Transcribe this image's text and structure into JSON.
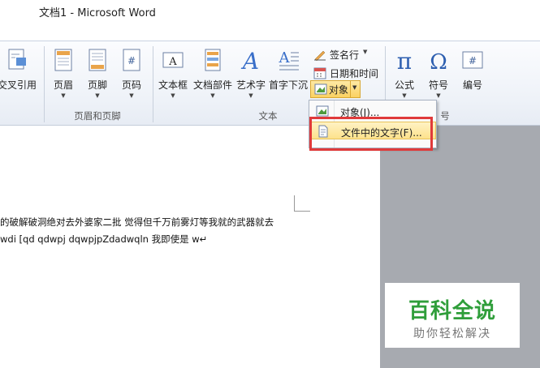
{
  "window": {
    "title": "文档1 - Microsoft Word"
  },
  "ribbon": {
    "buttons": {
      "cross_ref": "交叉引用",
      "header": "页眉",
      "footer": "页脚",
      "page_number": "页码",
      "text_box": "文本框",
      "quick_parts": "文档部件",
      "word_art": "艺术字",
      "drop_cap": "首字下沉",
      "signature_line": "签名行",
      "date_time": "日期和时间",
      "object": "对象",
      "equation": "公式",
      "symbol": "符号",
      "number": "编号"
    },
    "groups": {
      "header_footer": "页眉和页脚",
      "text": "文本",
      "symbols_partial": "号"
    }
  },
  "object_menu": {
    "items": [
      {
        "label": "对象(J)..."
      },
      {
        "label": "文件中的文字(F)..."
      }
    ]
  },
  "document": {
    "line1": "的破解破洞绝对去外婆家二批 觉得但千万前雾灯等我就的武器就去",
    "line2": "wdi [qd qdwpj dqwpjpZdadwqln 我即使是 w↵"
  },
  "watermark": {
    "title": "百科全说",
    "subtitle": "助你轻松解决"
  },
  "colors": {
    "highlight": "#fde28c",
    "annotation_box": "#e03a3a",
    "watermark_green": "#2f9e3a"
  }
}
